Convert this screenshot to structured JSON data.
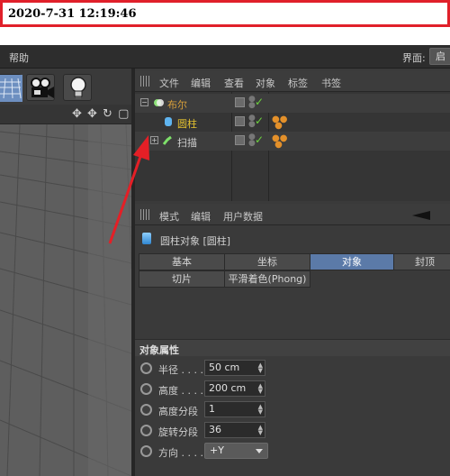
{
  "timestamp": "2020-7-31 12:19:46",
  "menubar": {
    "help": "帮助",
    "layout_label": "界面:",
    "layout_value": "启"
  },
  "toolbar": {
    "icons": [
      "perspective-grid-icon",
      "camera-icon",
      "light-bulb-icon"
    ]
  },
  "viewport": {
    "nav_icons": "✥ ✥ ↻ ▢"
  },
  "object_manager": {
    "menu": [
      "文件",
      "编辑",
      "查看",
      "对象",
      "标签",
      "书签"
    ],
    "objects": [
      {
        "name": "布尔",
        "icon": "boole-icon",
        "color": "#d9a03a"
      },
      {
        "name": "圆柱",
        "icon": "cylinder-icon",
        "color": "#e5c230"
      },
      {
        "name": "扫描",
        "icon": "sweep-icon",
        "color": "#c8c8c8"
      }
    ]
  },
  "attribute_manager": {
    "menu": [
      "模式",
      "编辑",
      "用户数据"
    ],
    "title": "圆柱对象 [圆柱]",
    "tabs_row1": [
      "基本",
      "坐标",
      "对象",
      "封顶"
    ],
    "tabs_row2": [
      "切片",
      "平滑着色(Phong)"
    ],
    "active_tab": "对象",
    "section": "对象属性",
    "properties": [
      {
        "label": "半径 . . . .",
        "value": "50 cm"
      },
      {
        "label": "高度 . . . .",
        "value": "200 cm"
      },
      {
        "label": "高度分段",
        "value": "1"
      },
      {
        "label": "旋转分段",
        "value": "36"
      },
      {
        "label": "方向 . . . .",
        "value": "+Y"
      }
    ]
  },
  "colors": {
    "accent_arrow": "#e41f26",
    "active_tab": "#5b7aa8",
    "check": "#6cd13e"
  }
}
